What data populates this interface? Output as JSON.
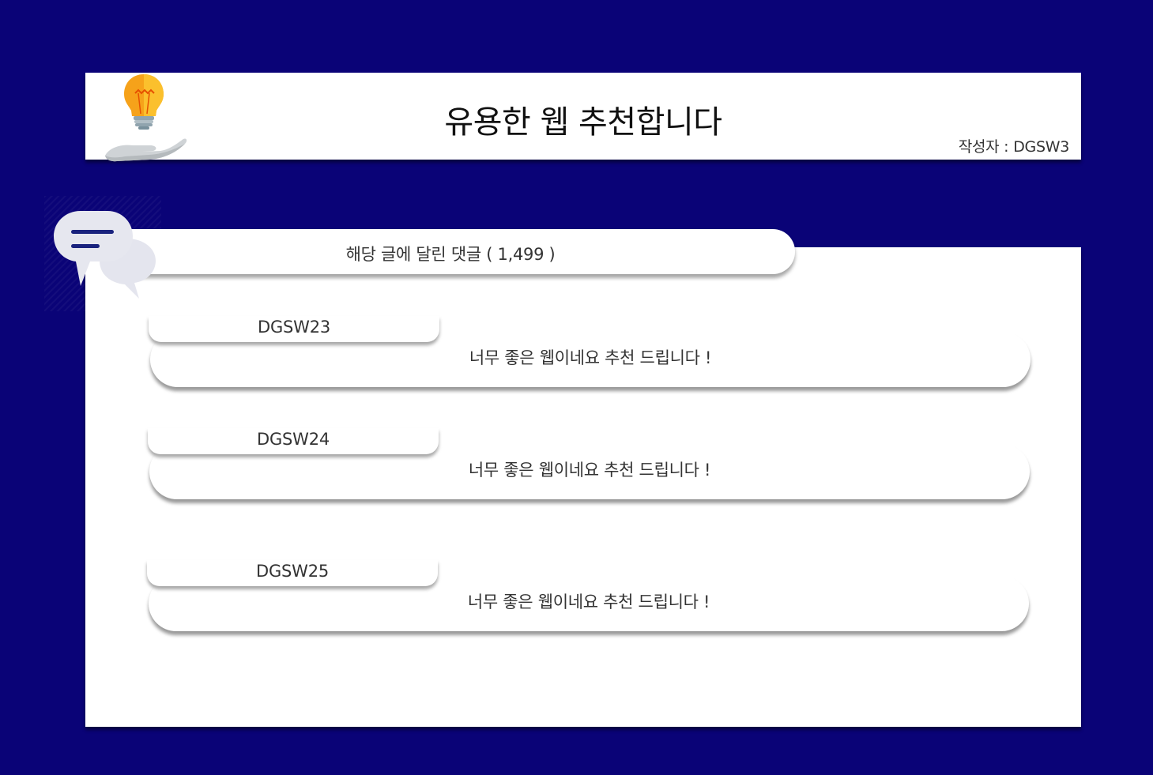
{
  "post": {
    "title": "유용한 웹 추천합니다",
    "author_label": "작성자 :",
    "author": "DGSW3"
  },
  "comments_section": {
    "count_label": "해당 글에 달린 댓글 ( 1,499 )"
  },
  "comments": [
    {
      "author": "DGSW23",
      "text": "너무 좋은 웹이네요 추천 드립니다 !"
    },
    {
      "author": "DGSW24",
      "text": "너무 좋은 웹이네요 추천 드립니다 !"
    },
    {
      "author": "DGSW25",
      "text": "너무 좋은 웹이네요 추천 드립니다 !"
    }
  ],
  "icons": {
    "logo": "lightbulb-hand-icon",
    "comments": "chat-bubbles-icon"
  },
  "colors": {
    "background": "#0a0377",
    "card": "#ffffff",
    "bulb": "#f7b21b",
    "chat_lines": "#1a237e"
  }
}
